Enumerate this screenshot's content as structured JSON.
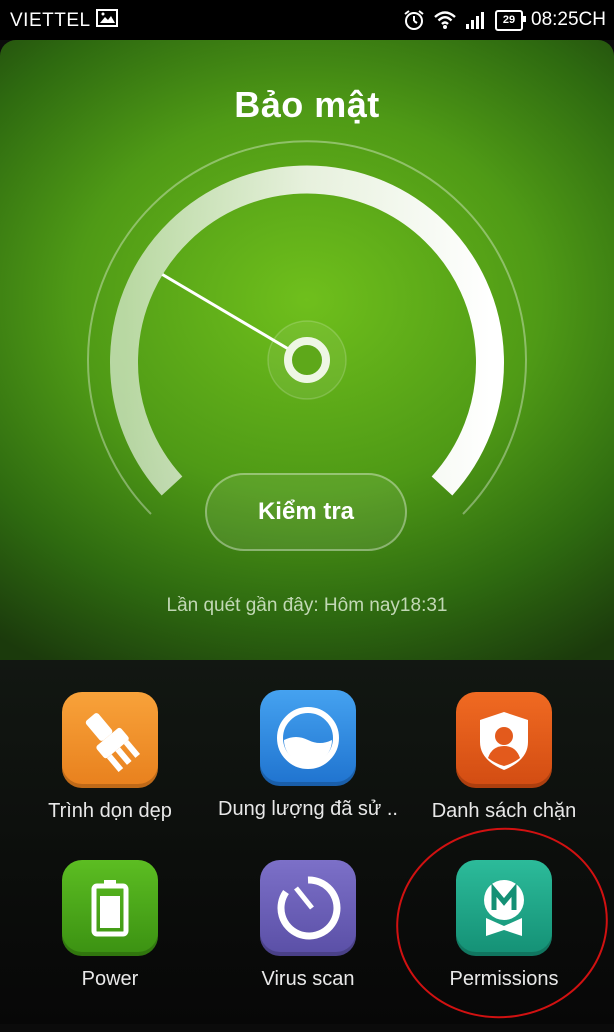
{
  "status_bar": {
    "carrier": "VIETTEL",
    "battery_level": "29",
    "time": "08:25CH",
    "icons": [
      "image-icon",
      "alarm-icon",
      "wifi-icon",
      "signal-icon",
      "battery-icon"
    ]
  },
  "header": {
    "title": "Bảo mật"
  },
  "gauge": {
    "needle_level": 0.28
  },
  "check_button": {
    "label": "Kiểm tra"
  },
  "last_scan": "Lần quét gần đây: Hôm nay18:31",
  "tiles": [
    {
      "label": "Trình dọn dẹp",
      "icon": "cleaner-brush-icon",
      "color": "#f0902a"
    },
    {
      "label": "Dung lượng đã sử ..",
      "icon": "data-usage-icon",
      "color": "#2f8be0"
    },
    {
      "label": "Danh sách chặn",
      "icon": "blocklist-shield-icon",
      "color": "#e35a1c"
    },
    {
      "label": "Power",
      "icon": "battery-power-icon",
      "color": "#49a51a"
    },
    {
      "label": "Virus scan",
      "icon": "virus-scan-icon",
      "color": "#6a5fb7"
    },
    {
      "label": "Permissions",
      "icon": "permissions-badge-icon",
      "color": "#1fa88a"
    }
  ],
  "annotation_color": "#d11111"
}
